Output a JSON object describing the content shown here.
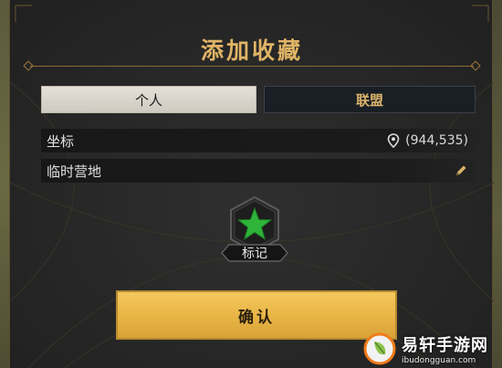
{
  "dialog": {
    "title": "添加收藏"
  },
  "tabs": [
    {
      "label": "个人",
      "active": true
    },
    {
      "label": "联盟",
      "active": false
    }
  ],
  "coordinate_field": {
    "label": "坐标",
    "value": "(944,535)",
    "icon": "location-pin-icon"
  },
  "name_field": {
    "value": "临时营地",
    "icon": "edit-pencil-icon"
  },
  "marker": {
    "icon": "green-star-icon",
    "label": "标记",
    "color": "#2fb43a"
  },
  "confirm_button": {
    "label": "确认"
  },
  "watermark": {
    "name": "易轩手游网",
    "url": "ibudongguan.com"
  },
  "colors": {
    "accent_gold": "#e0b466",
    "button_gold": "#e8b444",
    "panel_dark": "#262626"
  }
}
